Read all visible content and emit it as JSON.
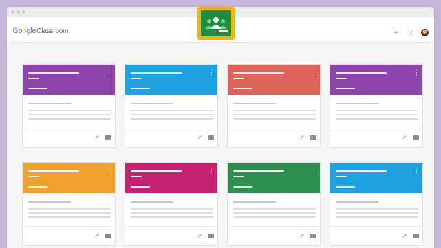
{
  "app": {
    "logo_text": "Google",
    "product_name": "Classroom"
  },
  "header": {
    "add_icon": "plus-icon",
    "apps_icon": "apps-grid-icon",
    "account_icon": "avatar"
  },
  "colors": {
    "purple": "#8e44ad",
    "blue": "#1ea1df",
    "red": "#dd6459",
    "yellow": "#f0a22e",
    "magenta": "#c4246f",
    "green": "#2e9050",
    "badge_yellow": "#f4b400",
    "badge_green": "#1e8e3e"
  },
  "classes": [
    {
      "color": "#8e44ad"
    },
    {
      "color": "#1ea1df"
    },
    {
      "color": "#dd6459"
    },
    {
      "color": "#8e44ad"
    },
    {
      "color": "#f0a22e"
    },
    {
      "color": "#c4246f"
    },
    {
      "color": "#2e9050"
    },
    {
      "color": "#1ea1df"
    }
  ],
  "card_icons": {
    "kebab": "more-vert-icon",
    "trend": "trending-icon",
    "folder": "folder-icon"
  }
}
